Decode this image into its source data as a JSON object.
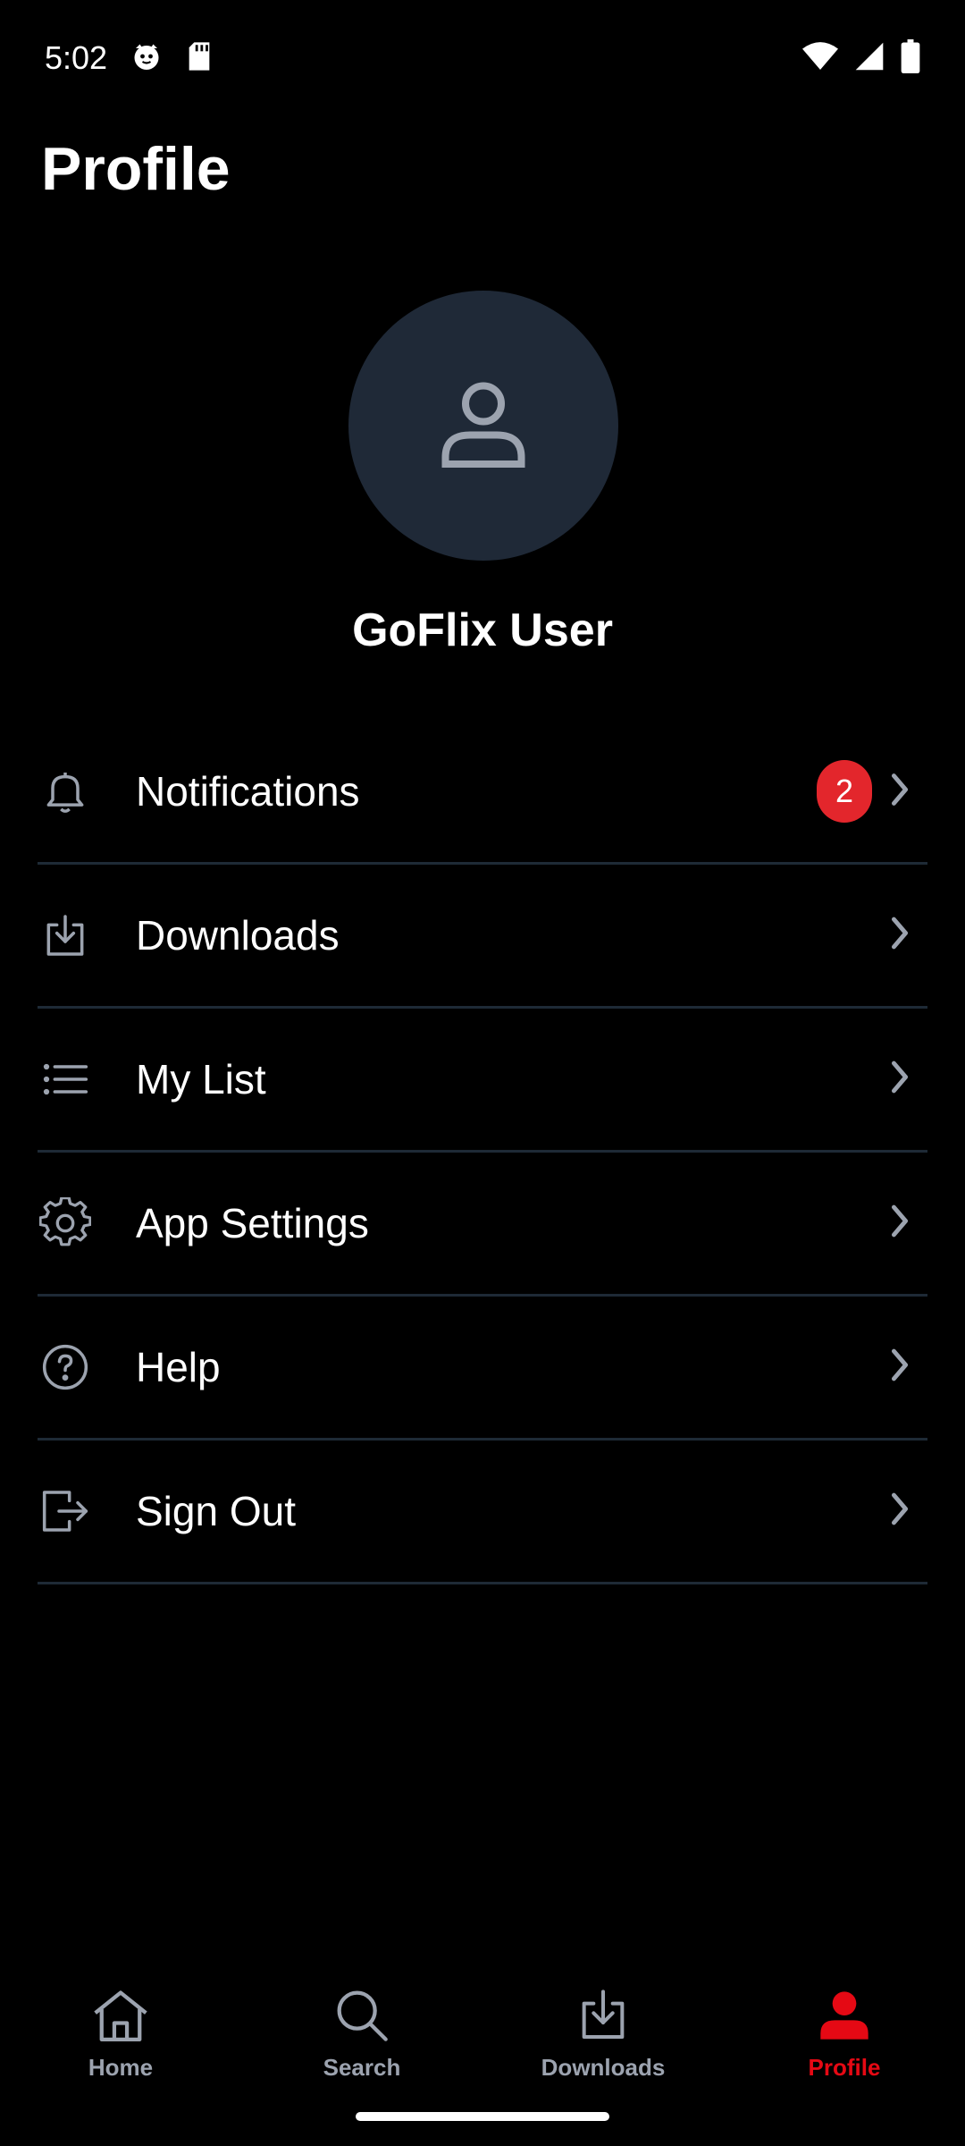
{
  "status_bar": {
    "time": "5:02",
    "icons": [
      "cat-face-icon",
      "sd-card-icon",
      "wifi-icon",
      "signal-icon",
      "battery-icon"
    ]
  },
  "page": {
    "title": "Profile"
  },
  "profile": {
    "avatar_icon": "person-icon",
    "name": "GoFlix User"
  },
  "menu": {
    "items": [
      {
        "label": "Notifications",
        "icon": "bell-icon",
        "badge": "2"
      },
      {
        "label": "Downloads",
        "icon": "download-icon"
      },
      {
        "label": "My List",
        "icon": "list-icon"
      },
      {
        "label": "App Settings",
        "icon": "gear-icon"
      },
      {
        "label": "Help",
        "icon": "help-circle-icon"
      },
      {
        "label": "Sign Out",
        "icon": "sign-out-icon"
      }
    ]
  },
  "bottom_nav": {
    "items": [
      {
        "label": "Home",
        "icon": "home-icon"
      },
      {
        "label": "Search",
        "icon": "search-icon"
      },
      {
        "label": "Downloads",
        "icon": "download-icon"
      },
      {
        "label": "Profile",
        "icon": "person-icon",
        "active": true
      }
    ]
  },
  "colors": {
    "background": "#000000",
    "accent": "#e50914",
    "badge": "#e3262c",
    "avatar_bg": "#1f2937",
    "divider": "#1e2a36",
    "muted": "#9ca3af"
  }
}
